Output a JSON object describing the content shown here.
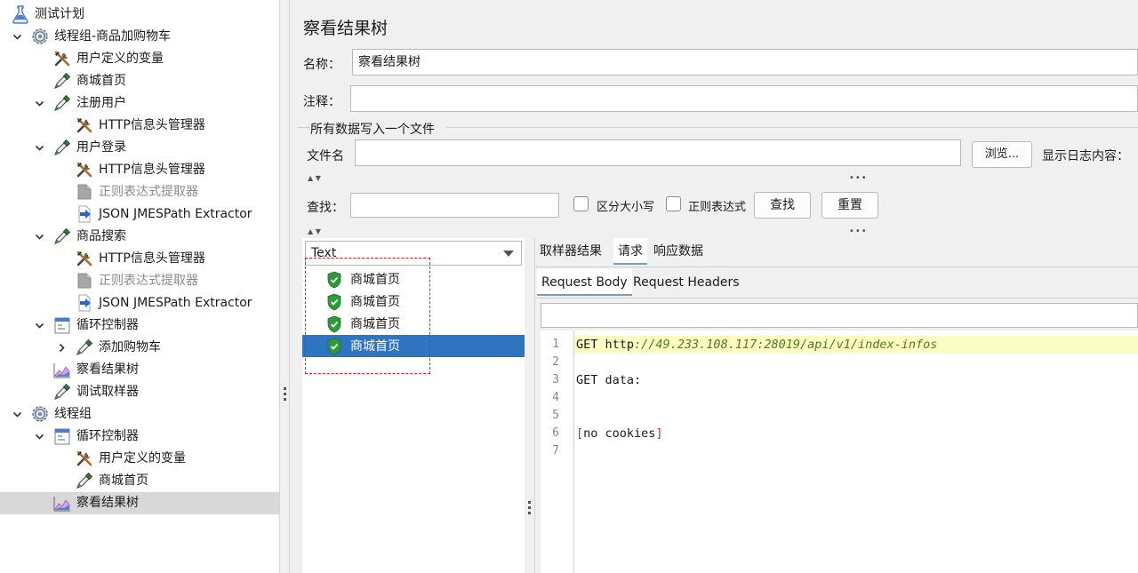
{
  "tree": {
    "items": [
      {
        "label": "测试计划",
        "icon": "flask-icon",
        "toggle": "",
        "level": 0
      },
      {
        "label": "线程组-商品加购物车",
        "icon": "gear-icon",
        "toggle": "expanded",
        "level": 1
      },
      {
        "label": "用户定义的变量",
        "icon": "wrench-icon",
        "toggle": "",
        "level": 2
      },
      {
        "label": "商城首页",
        "icon": "pipette-icon",
        "toggle": "",
        "level": 2
      },
      {
        "label": "注册用户",
        "icon": "pipette-icon",
        "toggle": "expanded",
        "level": 2
      },
      {
        "label": "HTTP信息头管理器",
        "icon": "wrench-icon",
        "toggle": "",
        "level": 3
      },
      {
        "label": "用户登录",
        "icon": "pipette-icon",
        "toggle": "expanded",
        "level": 2
      },
      {
        "label": "HTTP信息头管理器",
        "icon": "wrench-icon",
        "toggle": "",
        "level": 3
      },
      {
        "label": "正则表达式提取器",
        "icon": "extractor-disabled-icon",
        "toggle": "",
        "level": 3,
        "disabled": true
      },
      {
        "label": "JSON JMESPath Extractor",
        "icon": "extractor-arrow-icon",
        "toggle": "",
        "level": 3
      },
      {
        "label": "商品搜索",
        "icon": "pipette-icon",
        "toggle": "expanded",
        "level": 2
      },
      {
        "label": "HTTP信息头管理器",
        "icon": "wrench-icon",
        "toggle": "",
        "level": 3
      },
      {
        "label": "正则表达式提取器",
        "icon": "extractor-disabled-icon",
        "toggle": "",
        "level": 3,
        "disabled": true
      },
      {
        "label": "JSON JMESPath Extractor",
        "icon": "extractor-arrow-icon",
        "toggle": "",
        "level": 3
      },
      {
        "label": "循环控制器",
        "icon": "loop-controller-icon",
        "toggle": "expanded",
        "level": 2
      },
      {
        "label": "添加购物车",
        "icon": "pipette-icon",
        "toggle": "collapsed",
        "level": 3
      },
      {
        "label": "察看结果树",
        "icon": "chart-listener-icon",
        "toggle": "",
        "level": 2
      },
      {
        "label": "调试取样器",
        "icon": "pipette-icon",
        "toggle": "",
        "level": 2
      },
      {
        "label": "线程组",
        "icon": "gear-icon",
        "toggle": "expanded",
        "level": 1
      },
      {
        "label": "循环控制器",
        "icon": "loop-controller-icon",
        "toggle": "expanded",
        "level": 2
      },
      {
        "label": "用户定义的变量",
        "icon": "wrench-icon",
        "toggle": "",
        "level": 3
      },
      {
        "label": "商城首页",
        "icon": "pipette-icon",
        "toggle": "",
        "level": 3
      },
      {
        "label": "察看结果树",
        "icon": "chart-listener-icon",
        "toggle": "",
        "level": 2,
        "selected": true
      }
    ]
  },
  "editor": {
    "title": "察看结果树",
    "name_label": "名称：",
    "name_value": "察看结果树",
    "comment_label": "注释：",
    "comment_value": "",
    "file_section_title": "所有数据写入一个文件",
    "filename_label": "文件名",
    "filename_value": "",
    "browse_label": "浏览...",
    "show_log_label": "显示日志内容：",
    "search_label": "查找：",
    "search_value": "",
    "case_sensitive_label": "区分大小写",
    "regex_label": "正则表达式",
    "find_button": "查找",
    "reset_button": "重置"
  },
  "results": {
    "renderer_selected": "Text",
    "items": [
      {
        "label": "商城首页",
        "status": "success-shield-icon"
      },
      {
        "label": "商城首页",
        "status": "success-shield-icon"
      },
      {
        "label": "商城首页",
        "status": "success-shield-icon"
      },
      {
        "label": "商城首页",
        "status": "success-shield-icon",
        "selected": true
      }
    ]
  },
  "detail": {
    "tabs": [
      "取样器结果",
      "请求",
      "响应数据"
    ],
    "active_tab": "请求",
    "subtabs": [
      "Request Body",
      "Request Headers"
    ],
    "active_subtab": "Request Body",
    "search_value": "",
    "lines": [
      {
        "num": "1",
        "prefix": "GET http",
        "url": "://49.233.108.117:28019/api/v1/index-infos"
      },
      {
        "num": "2",
        "text": ""
      },
      {
        "num": "3",
        "text": "GET data:"
      },
      {
        "num": "4",
        "text": ""
      },
      {
        "num": "5",
        "text": ""
      },
      {
        "num": "6",
        "open": "[",
        "text": "no cookies",
        "close": "]"
      },
      {
        "num": "7",
        "text": ""
      }
    ]
  },
  "colors": {
    "selection": "#2f74c0",
    "highlight_line": "#fdfdc3",
    "annotation_box": "#e02020",
    "success_shield": "#2e9a3a"
  }
}
